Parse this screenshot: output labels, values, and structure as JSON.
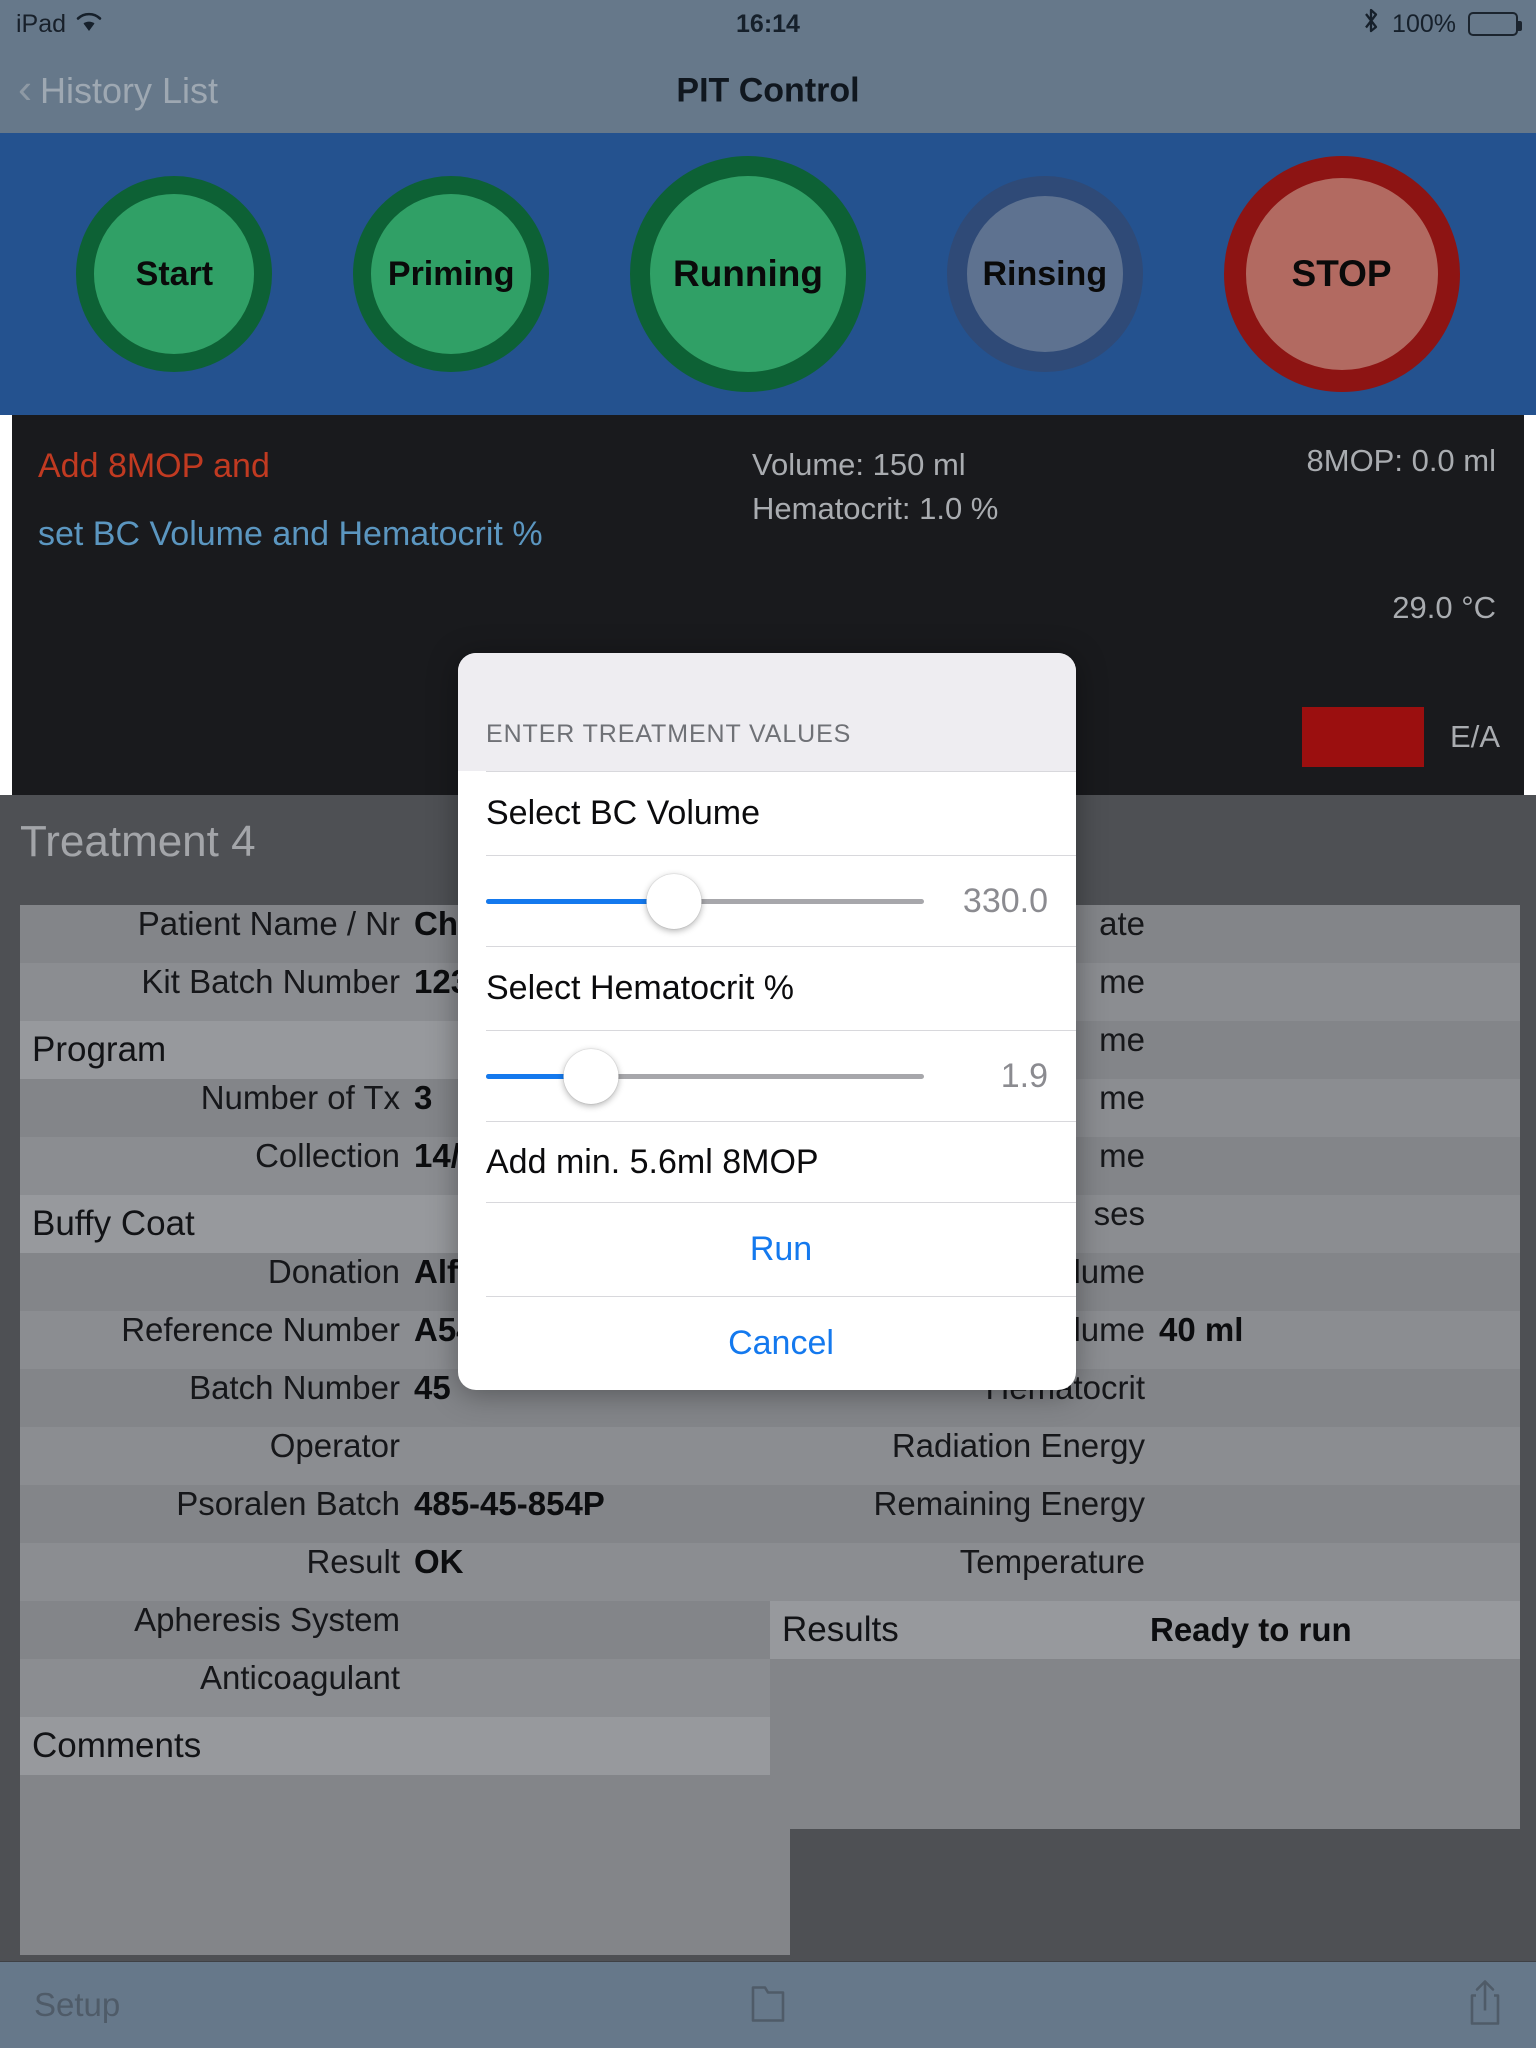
{
  "status_bar": {
    "device": "iPad",
    "wifi_icon": "wifi-icon",
    "time": "16:14",
    "bluetooth_icon": "bluetooth-icon",
    "battery_percent": "100%"
  },
  "nav_bar": {
    "back_label": "History List",
    "back_chevron": "‹",
    "title": "PIT Control"
  },
  "state_panel": {
    "background_color": "#24528f",
    "circles": [
      {
        "label": "Start",
        "fill": "#30a066",
        "ring": "#0d6135",
        "active": true
      },
      {
        "label": "Priming",
        "fill": "#30a066",
        "ring": "#0d6135",
        "active": true
      },
      {
        "label": "Running",
        "fill": "#30a066",
        "ring": "#0d6135",
        "active": true
      },
      {
        "label": "Rinsing",
        "fill": "#5e7290",
        "ring": "#2f4a77",
        "active": false
      },
      {
        "label": "STOP",
        "fill": "#b26a61",
        "ring": "#8d1413",
        "active": false
      }
    ]
  },
  "readout": {
    "message_line1": "Add 8MOP and",
    "message_line1_color": "#c13a21",
    "message_line2": "set BC Volume and Hematocrit %",
    "message_line2_color": "#5b96c0",
    "volume": "Volume: 150 ml",
    "hematocrit": "Hematocrit: 1.0 %",
    "mop": "8MOP: 0.0 ml",
    "temperature": "29.0 °C",
    "ea_label": "E/A",
    "ea_indicator_color": "#9b0f0f"
  },
  "content": {
    "title": "Treatment 4",
    "left_column": [
      {
        "type": "row",
        "label": "Patient Name / Nr",
        "value": "Chr"
      },
      {
        "type": "row",
        "label": "Kit Batch Number",
        "value": "123"
      },
      {
        "type": "section",
        "label": "Program"
      },
      {
        "type": "row",
        "label": "Number of Tx",
        "value": "3"
      },
      {
        "type": "row",
        "label": "Collection",
        "value": "14/"
      },
      {
        "type": "section",
        "label": "Buffy Coat"
      },
      {
        "type": "row",
        "label": "Donation",
        "value": "Alfa"
      },
      {
        "type": "row",
        "label": "Reference Number",
        "value": "A54"
      },
      {
        "type": "row",
        "label": "Batch Number",
        "value": "45"
      },
      {
        "type": "row",
        "label": "Operator",
        "value": ""
      },
      {
        "type": "row",
        "label": "Psoralen Batch",
        "value": "485-45-854P"
      },
      {
        "type": "row",
        "label": "Result",
        "value": "OK"
      },
      {
        "type": "row",
        "label": "Apheresis System",
        "value": ""
      },
      {
        "type": "row",
        "label": "Anticoagulant",
        "value": ""
      },
      {
        "type": "section",
        "label": "Comments"
      }
    ],
    "right_column": [
      {
        "type": "row",
        "label": "ate",
        "value": ""
      },
      {
        "type": "row",
        "label": "me",
        "value": ""
      },
      {
        "type": "row",
        "label": "me",
        "value": ""
      },
      {
        "type": "row",
        "label": "me",
        "value": ""
      },
      {
        "type": "row",
        "label": "me",
        "value": ""
      },
      {
        "type": "row",
        "label": "ses",
        "value": ""
      },
      {
        "type": "row",
        "label": "BC Volume",
        "value": ""
      },
      {
        "type": "row",
        "label": "Priming Volume",
        "value": "40 ml"
      },
      {
        "type": "row",
        "label": "Hematocrit",
        "value": ""
      },
      {
        "type": "row",
        "label": "Radiation Energy",
        "value": ""
      },
      {
        "type": "row",
        "label": "Remaining Energy",
        "value": ""
      },
      {
        "type": "row",
        "label": "Temperature",
        "value": ""
      },
      {
        "type": "section_value",
        "label": "Results",
        "value": "Ready to run"
      }
    ]
  },
  "modal": {
    "header_title": "ENTER TREATMENT VALUES",
    "bc_volume": {
      "label": "Select BC Volume",
      "value": "330.0",
      "fill_percent": 43
    },
    "hematocrit": {
      "label": "Select Hematocrit %",
      "value": "1.9",
      "fill_percent": 24
    },
    "note": "Add min. 5.6ml 8MOP",
    "run_label": "Run",
    "cancel_label": "Cancel",
    "accent_color": "#1479ee"
  },
  "toolbar": {
    "setup_label": "Setup",
    "folder_icon": "folder-icon",
    "share_icon": "share-icon"
  }
}
